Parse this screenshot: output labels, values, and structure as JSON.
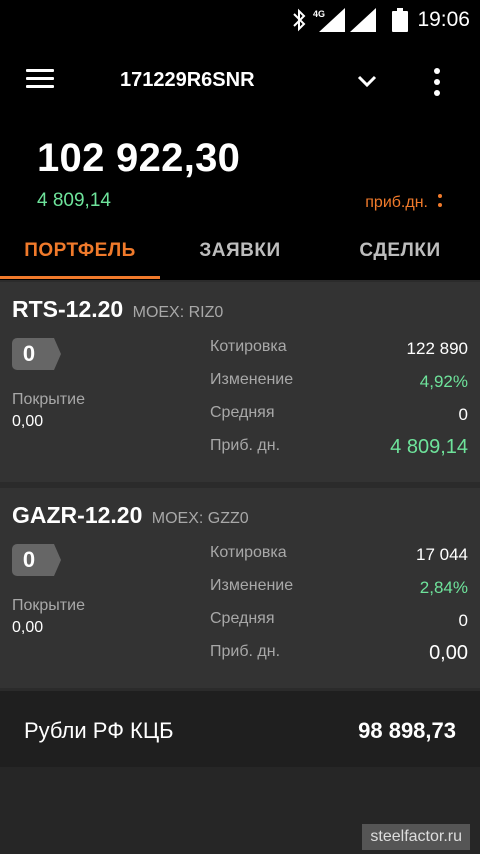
{
  "status_bar": {
    "network_label": "4G",
    "time": "19:06"
  },
  "app_bar": {
    "account": "171229R6SNR"
  },
  "summary": {
    "total": "102 922,30",
    "pnl": "4 809,14",
    "pnl_label": "приб.дн."
  },
  "tabs": [
    {
      "label": "ПОРТФЕЛЬ",
      "active": true
    },
    {
      "label": "ЗАЯВКИ",
      "active": false
    },
    {
      "label": "СДЕЛКИ",
      "active": false
    }
  ],
  "positions": [
    {
      "ticker": "RTS-12.20",
      "exchange": "MOEX: RIZ0",
      "qty": "0",
      "coverage_label": "Покрытие",
      "coverage_value": "0,00",
      "rows": [
        {
          "label": "Котировка",
          "value": "122 890"
        },
        {
          "label": "Изменение",
          "value": "4,92%"
        },
        {
          "label": "Средняя",
          "value": "0"
        },
        {
          "label": "Приб. дн.",
          "value": "4 809,14"
        }
      ]
    },
    {
      "ticker": "GAZR-12.20",
      "exchange": "MOEX: GZZ0",
      "qty": "0",
      "coverage_label": "Покрытие",
      "coverage_value": "0,00",
      "rows": [
        {
          "label": "Котировка",
          "value": "17 044"
        },
        {
          "label": "Изменение",
          "value": "2,84%"
        },
        {
          "label": "Средняя",
          "value": "0"
        },
        {
          "label": "Приб. дн.",
          "value": "0,00"
        }
      ]
    }
  ],
  "cash": {
    "label": "Рубли РФ КЦБ",
    "value": "98 898,73"
  },
  "watermark": "steelfactor.ru",
  "colors": {
    "accent": "#f07a2b",
    "positive": "#6ee39b",
    "background": "#2b2b2b"
  }
}
